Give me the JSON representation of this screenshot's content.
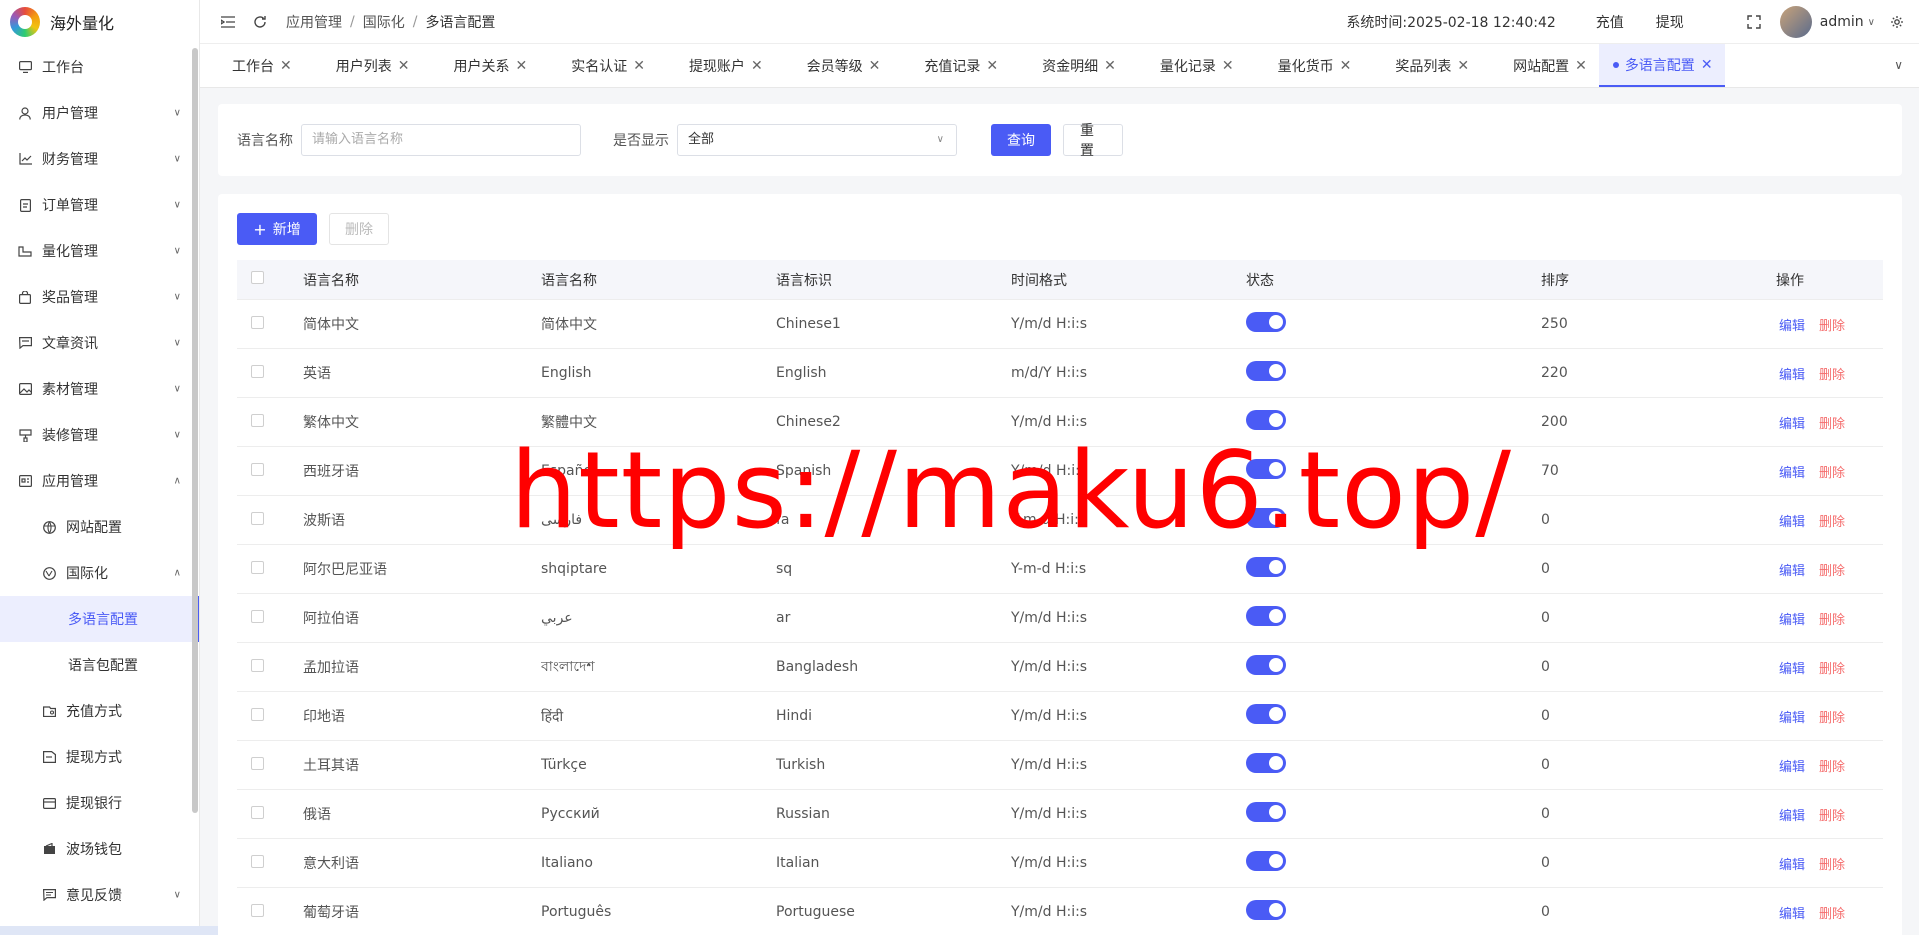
{
  "app": {
    "title": "海外量化"
  },
  "sidebar": {
    "items": [
      {
        "label": "工作台",
        "icon": "monitor-icon",
        "level": 0,
        "chevron": ""
      },
      {
        "label": "用户管理",
        "icon": "user-icon",
        "level": 0,
        "chevron": "down"
      },
      {
        "label": "财务管理",
        "icon": "chart-icon",
        "level": 0,
        "chevron": "down"
      },
      {
        "label": "订单管理",
        "icon": "document-icon",
        "level": 0,
        "chevron": "down"
      },
      {
        "label": "量化管理",
        "icon": "scale-icon",
        "level": 0,
        "chevron": "down"
      },
      {
        "label": "奖品管理",
        "icon": "bag-icon",
        "level": 0,
        "chevron": "down"
      },
      {
        "label": "文章资讯",
        "icon": "message-icon",
        "level": 0,
        "chevron": "down"
      },
      {
        "label": "素材管理",
        "icon": "image-icon",
        "level": 0,
        "chevron": "down"
      },
      {
        "label": "装修管理",
        "icon": "paint-icon",
        "level": 0,
        "chevron": "down"
      },
      {
        "label": "应用管理",
        "icon": "app-icon",
        "level": 0,
        "chevron": "up"
      },
      {
        "label": "网站配置",
        "icon": "globe-icon",
        "level": 1,
        "chevron": ""
      },
      {
        "label": "国际化",
        "icon": "language-icon",
        "level": 1,
        "chevron": "up"
      },
      {
        "label": "多语言配置",
        "icon": "",
        "level": 2,
        "chevron": "",
        "active": true
      },
      {
        "label": "语言包配置",
        "icon": "",
        "level": 2,
        "chevron": ""
      },
      {
        "label": "充值方式",
        "icon": "recharge-icon",
        "level": 1,
        "chevron": ""
      },
      {
        "label": "提现方式",
        "icon": "withdraw-icon",
        "level": 1,
        "chevron": ""
      },
      {
        "label": "提现银行",
        "icon": "bank-card-icon",
        "level": 1,
        "chevron": ""
      },
      {
        "label": "波场钱包",
        "icon": "wallet-icon",
        "level": 1,
        "chevron": ""
      },
      {
        "label": "意见反馈",
        "icon": "feedback-icon",
        "level": 1,
        "chevron": "down"
      }
    ]
  },
  "header": {
    "breadcrumb": [
      "应用管理",
      "国际化",
      "多语言配置"
    ],
    "system_time_label": "系统时间:",
    "system_time": "2025-02-18 12:40:42",
    "recharge": "充值",
    "withdraw": "提现",
    "user": "admin"
  },
  "tabs": [
    {
      "label": "工作台"
    },
    {
      "label": "用户列表"
    },
    {
      "label": "用户关系"
    },
    {
      "label": "实名认证"
    },
    {
      "label": "提现账户"
    },
    {
      "label": "会员等级"
    },
    {
      "label": "充值记录"
    },
    {
      "label": "资金明细"
    },
    {
      "label": "量化记录"
    },
    {
      "label": "量化货币"
    },
    {
      "label": "奖品列表"
    },
    {
      "label": "网站配置"
    },
    {
      "label": "多语言配置",
      "active": true
    }
  ],
  "search": {
    "name_label": "语言名称",
    "name_placeholder": "请输入语言名称",
    "show_label": "是否显示",
    "show_value": "全部",
    "query": "查询",
    "reset": "重置"
  },
  "toolbar": {
    "add": "新增",
    "delete": "删除"
  },
  "table": {
    "headers": [
      "语言名称",
      "语言名称",
      "语言标识",
      "时间格式",
      "状态",
      "排序",
      "操作"
    ],
    "edit": "编辑",
    "delete": "删除",
    "rows": [
      {
        "name": "简体中文",
        "native": "简体中文",
        "code": "Chinese1",
        "format": "Y/m/d H:i:s",
        "enabled": true,
        "sort": "250"
      },
      {
        "name": "英语",
        "native": "English",
        "code": "English",
        "format": "m/d/Y H:i:s",
        "enabled": true,
        "sort": "220"
      },
      {
        "name": "繁体中文",
        "native": "繁體中文",
        "code": "Chinese2",
        "format": "Y/m/d H:i:s",
        "enabled": true,
        "sort": "200"
      },
      {
        "name": "西班牙语",
        "native": "Español",
        "code": "Spanish",
        "format": "Y/m/d H:i:s",
        "enabled": true,
        "sort": "70"
      },
      {
        "name": "波斯语",
        "native": "فارسی",
        "code": "fa",
        "format": "Y-m-d H:i:s",
        "enabled": true,
        "sort": "0"
      },
      {
        "name": "阿尔巴尼亚语",
        "native": "shqiptare",
        "code": "sq",
        "format": "Y-m-d H:i:s",
        "enabled": true,
        "sort": "0"
      },
      {
        "name": "阿拉伯语",
        "native": "عربي",
        "code": "ar",
        "format": "Y/m/d H:i:s",
        "enabled": true,
        "sort": "0"
      },
      {
        "name": "孟加拉语",
        "native": "বাংলাদেশ",
        "code": "Bangladesh",
        "format": "Y/m/d H:i:s",
        "enabled": true,
        "sort": "0"
      },
      {
        "name": "印地语",
        "native": "हिंदी",
        "code": "Hindi",
        "format": "Y/m/d H:i:s",
        "enabled": true,
        "sort": "0"
      },
      {
        "name": "土耳其语",
        "native": "Türkçe",
        "code": "Turkish",
        "format": "Y/m/d H:i:s",
        "enabled": true,
        "sort": "0"
      },
      {
        "name": "俄语",
        "native": "Русский",
        "code": "Russian",
        "format": "Y/m/d H:i:s",
        "enabled": true,
        "sort": "0"
      },
      {
        "name": "意大利语",
        "native": "Italiano",
        "code": "Italian",
        "format": "Y/m/d H:i:s",
        "enabled": true,
        "sort": "0"
      },
      {
        "name": "葡萄牙语",
        "native": "Português",
        "code": "Portuguese",
        "format": "Y/m/d H:i:s",
        "enabled": true,
        "sort": "0"
      }
    ]
  },
  "watermark": "https://maku6.top/",
  "colors": {
    "primary": "#4a5bf5",
    "danger": "#f56c6c",
    "watermark": "#ff0000"
  }
}
